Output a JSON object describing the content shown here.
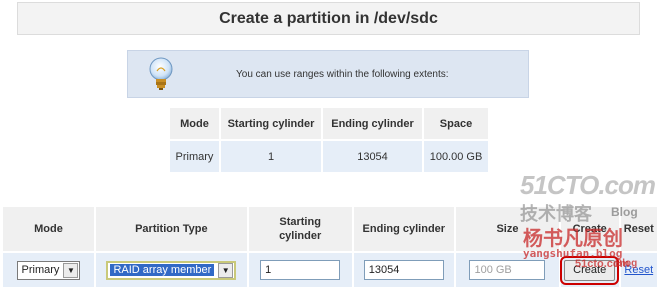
{
  "title": "Create a partition in /dev/sdc",
  "info": {
    "icon": "lightbulb-icon",
    "message": "You can use ranges within the following extents:"
  },
  "extents": {
    "headers": [
      "Mode",
      "Starting cylinder",
      "Ending cylinder",
      "Space"
    ],
    "rows": [
      [
        "Primary",
        "1",
        "13054",
        "100.00 GB"
      ]
    ]
  },
  "partition_form": {
    "headers": {
      "mode": "Mode",
      "type": "Partition Type",
      "start_line1": "Starting",
      "start_line2": "cylinder",
      "end": "Ending cylinder",
      "size": "Size",
      "create": "Create",
      "reset": "Reset"
    },
    "mode_value": "Primary",
    "type_value": "RAID array member",
    "start_value": "1",
    "end_value": "13054",
    "size_placeholder": "100 GB",
    "create_button": "Create",
    "reset_link": "Reset"
  },
  "watermark": {
    "line1": "51CTO.com",
    "line2": "技术博客",
    "line3": "Blog",
    "line4": "杨书凡原创",
    "line5": "yangshufan.blog",
    "line6": "51cto.com",
    "line7": "Blog"
  }
}
